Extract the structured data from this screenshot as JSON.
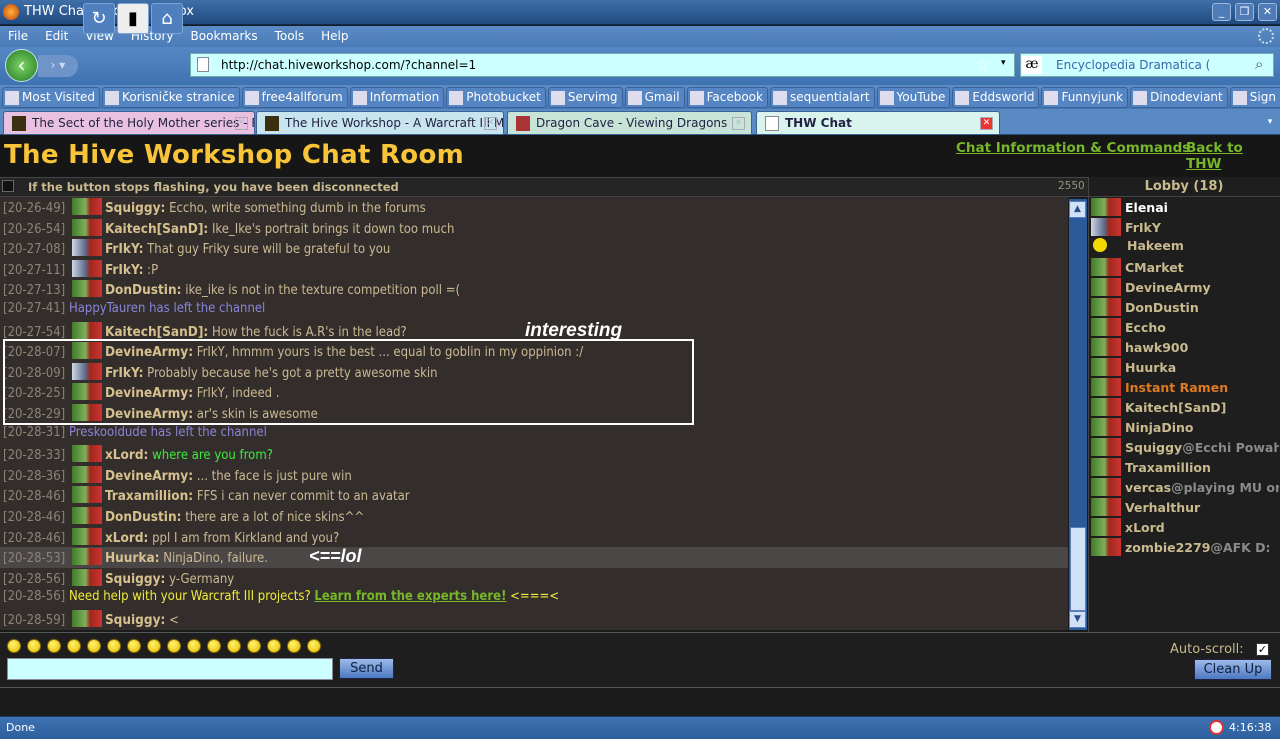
{
  "window": {
    "title": "THW Chat - Mozilla Firefox"
  },
  "menu": [
    "File",
    "Edit",
    "View",
    "History",
    "Bookmarks",
    "Tools",
    "Help"
  ],
  "nav": {
    "url": "http://chat.hiveworkshop.com/?channel=1",
    "search_placeholder": "Encyclopedia Dramatica ("
  },
  "bookmarks": [
    "Most Visited",
    "Korisničke stranice",
    "free4allforum",
    "Information",
    "Photobucket",
    "Servimg",
    "Gmail",
    "Facebook",
    "sequentialart",
    "YouTube",
    "Eddsworld",
    "Funnyjunk",
    "Dinodeviant",
    "Sign In"
  ],
  "tabs": [
    {
      "label": "The Sect of the Holy Mother series - Pa...",
      "active": false
    },
    {
      "label": "The Hive Workshop - A Warcraft III Mo...",
      "active": false
    },
    {
      "label": "Dragon Cave - Viewing Dragons",
      "active": false
    },
    {
      "label": "THW Chat",
      "active": true
    }
  ],
  "page": {
    "title": "The Hive Workshop Chat Room",
    "links": [
      "Chat Information & Commands",
      "Back to THW"
    ],
    "notice": "If the button stops flashing, you have been disconnected",
    "counter": "2550",
    "lobby": "Lobby (18)"
  },
  "chat": [
    {
      "ts": "[20-26-49]",
      "nick": "Squiggy:",
      "msg": "Eccho, write something dumb in the forums",
      "type": "msg"
    },
    {
      "ts": "[20-26-54]",
      "nick": "Kaitech[SanD]:",
      "msg": "Ike_Ike's portrait brings it down too much",
      "type": "msg"
    },
    {
      "ts": "[20-27-08]",
      "nick": "FrIkY:",
      "msg": "That guy Friky sure will be grateful to you",
      "type": "msg",
      "avatar": "friky"
    },
    {
      "ts": "[20-27-11]",
      "nick": "FrIkY:",
      "msg": ":P",
      "type": "msg",
      "avatar": "friky"
    },
    {
      "ts": "[20-27-13]",
      "nick": "DonDustin:",
      "msg": "ike_ike is not in the texture competition poll =(",
      "type": "msg"
    },
    {
      "ts": "[20-27-41]",
      "msg": "HappyTauren has left the channel",
      "type": "sys"
    },
    {
      "ts": "[20-27-54]",
      "nick": "Kaitech[SanD]:",
      "msg": "How the fuck is A.R's in the lead?",
      "type": "msg"
    },
    {
      "ts": "[20-28-07]",
      "nick": "DevineArmy:",
      "msg": "FrIkY, hmmm yours is the best ... equal to goblin in my oppinion :/",
      "type": "msg"
    },
    {
      "ts": "[20-28-09]",
      "nick": "FrIkY:",
      "msg": "Probably because he's got a pretty awesome skin",
      "type": "msg",
      "avatar": "friky"
    },
    {
      "ts": "[20-28-25]",
      "nick": "DevineArmy:",
      "msg": "FrIkY, indeed .",
      "type": "msg"
    },
    {
      "ts": "[20-28-29]",
      "nick": "DevineArmy:",
      "msg": "ar's skin is awesome",
      "type": "msg"
    },
    {
      "ts": "[20-28-31]",
      "msg": "Preskooldude has left the channel",
      "type": "sys"
    },
    {
      "ts": "[20-28-33]",
      "nick": "xLord:",
      "msg": "where are you from?",
      "type": "msg",
      "color": "green"
    },
    {
      "ts": "[20-28-36]",
      "nick": "DevineArmy:",
      "msg": "... the face is just pure win",
      "type": "msg"
    },
    {
      "ts": "[20-28-46]",
      "nick": "Traxamillion:",
      "msg": "FFS i can never commit to an avatar",
      "type": "msg"
    },
    {
      "ts": "[20-28-46]",
      "nick": "DonDustin:",
      "msg": "there are a lot of nice skins^^",
      "type": "msg"
    },
    {
      "ts": "[20-28-46]",
      "nick": "xLord:",
      "msg": "ppl I am from Kirkland and you?",
      "type": "msg"
    },
    {
      "ts": "[20-28-53]",
      "nick": "Huurka:",
      "msg": "NinjaDino, failure.",
      "type": "msg",
      "highlight": true
    },
    {
      "ts": "[20-28-56]",
      "nick": "Squiggy:",
      "msg": "y-Germany",
      "type": "msg"
    },
    {
      "ts": "[20-28-56]",
      "msg": "Need help with your Warcraft III projects?",
      "link": "Learn from the experts here!",
      "after": "<===<",
      "type": "ad"
    },
    {
      "ts": "[20-28-59]",
      "nick": "Squiggy:",
      "msg": "<",
      "type": "msg"
    }
  ],
  "annotations": {
    "interesting": "interesting",
    "lol": "<==lol"
  },
  "users": [
    {
      "name": "Elenai",
      "color": "#ffffff"
    },
    {
      "name": "FrIkY",
      "avatar": "friky"
    },
    {
      "name": "Hakeem",
      "avatar": "smiley"
    },
    {
      "name": "CMarket"
    },
    {
      "name": "DevineArmy"
    },
    {
      "name": "DonDustin"
    },
    {
      "name": "Eccho"
    },
    {
      "name": "hawk900"
    },
    {
      "name": "Huurka"
    },
    {
      "name": "Instant Ramen",
      "color": "#e07a22"
    },
    {
      "name": "Kaitech[SanD]"
    },
    {
      "name": "NinjaDino"
    },
    {
      "name": "Squiggy",
      "status": "@Ecchi Powahz"
    },
    {
      "name": "Traxamillion"
    },
    {
      "name": "vercas",
      "status": "@playing MU onli"
    },
    {
      "name": "Verhalthur"
    },
    {
      "name": "xLord"
    },
    {
      "name": "zombie2279",
      "status": "@AFK D:"
    }
  ],
  "bottom": {
    "send": "Send",
    "autoscroll_label": "Auto-scroll:",
    "autoscroll_checked": true,
    "cleanup": "Clean Up",
    "input_value": "",
    "smiley_count": 16
  },
  "statusbar": {
    "text": "Done",
    "time": "4:16:38"
  }
}
